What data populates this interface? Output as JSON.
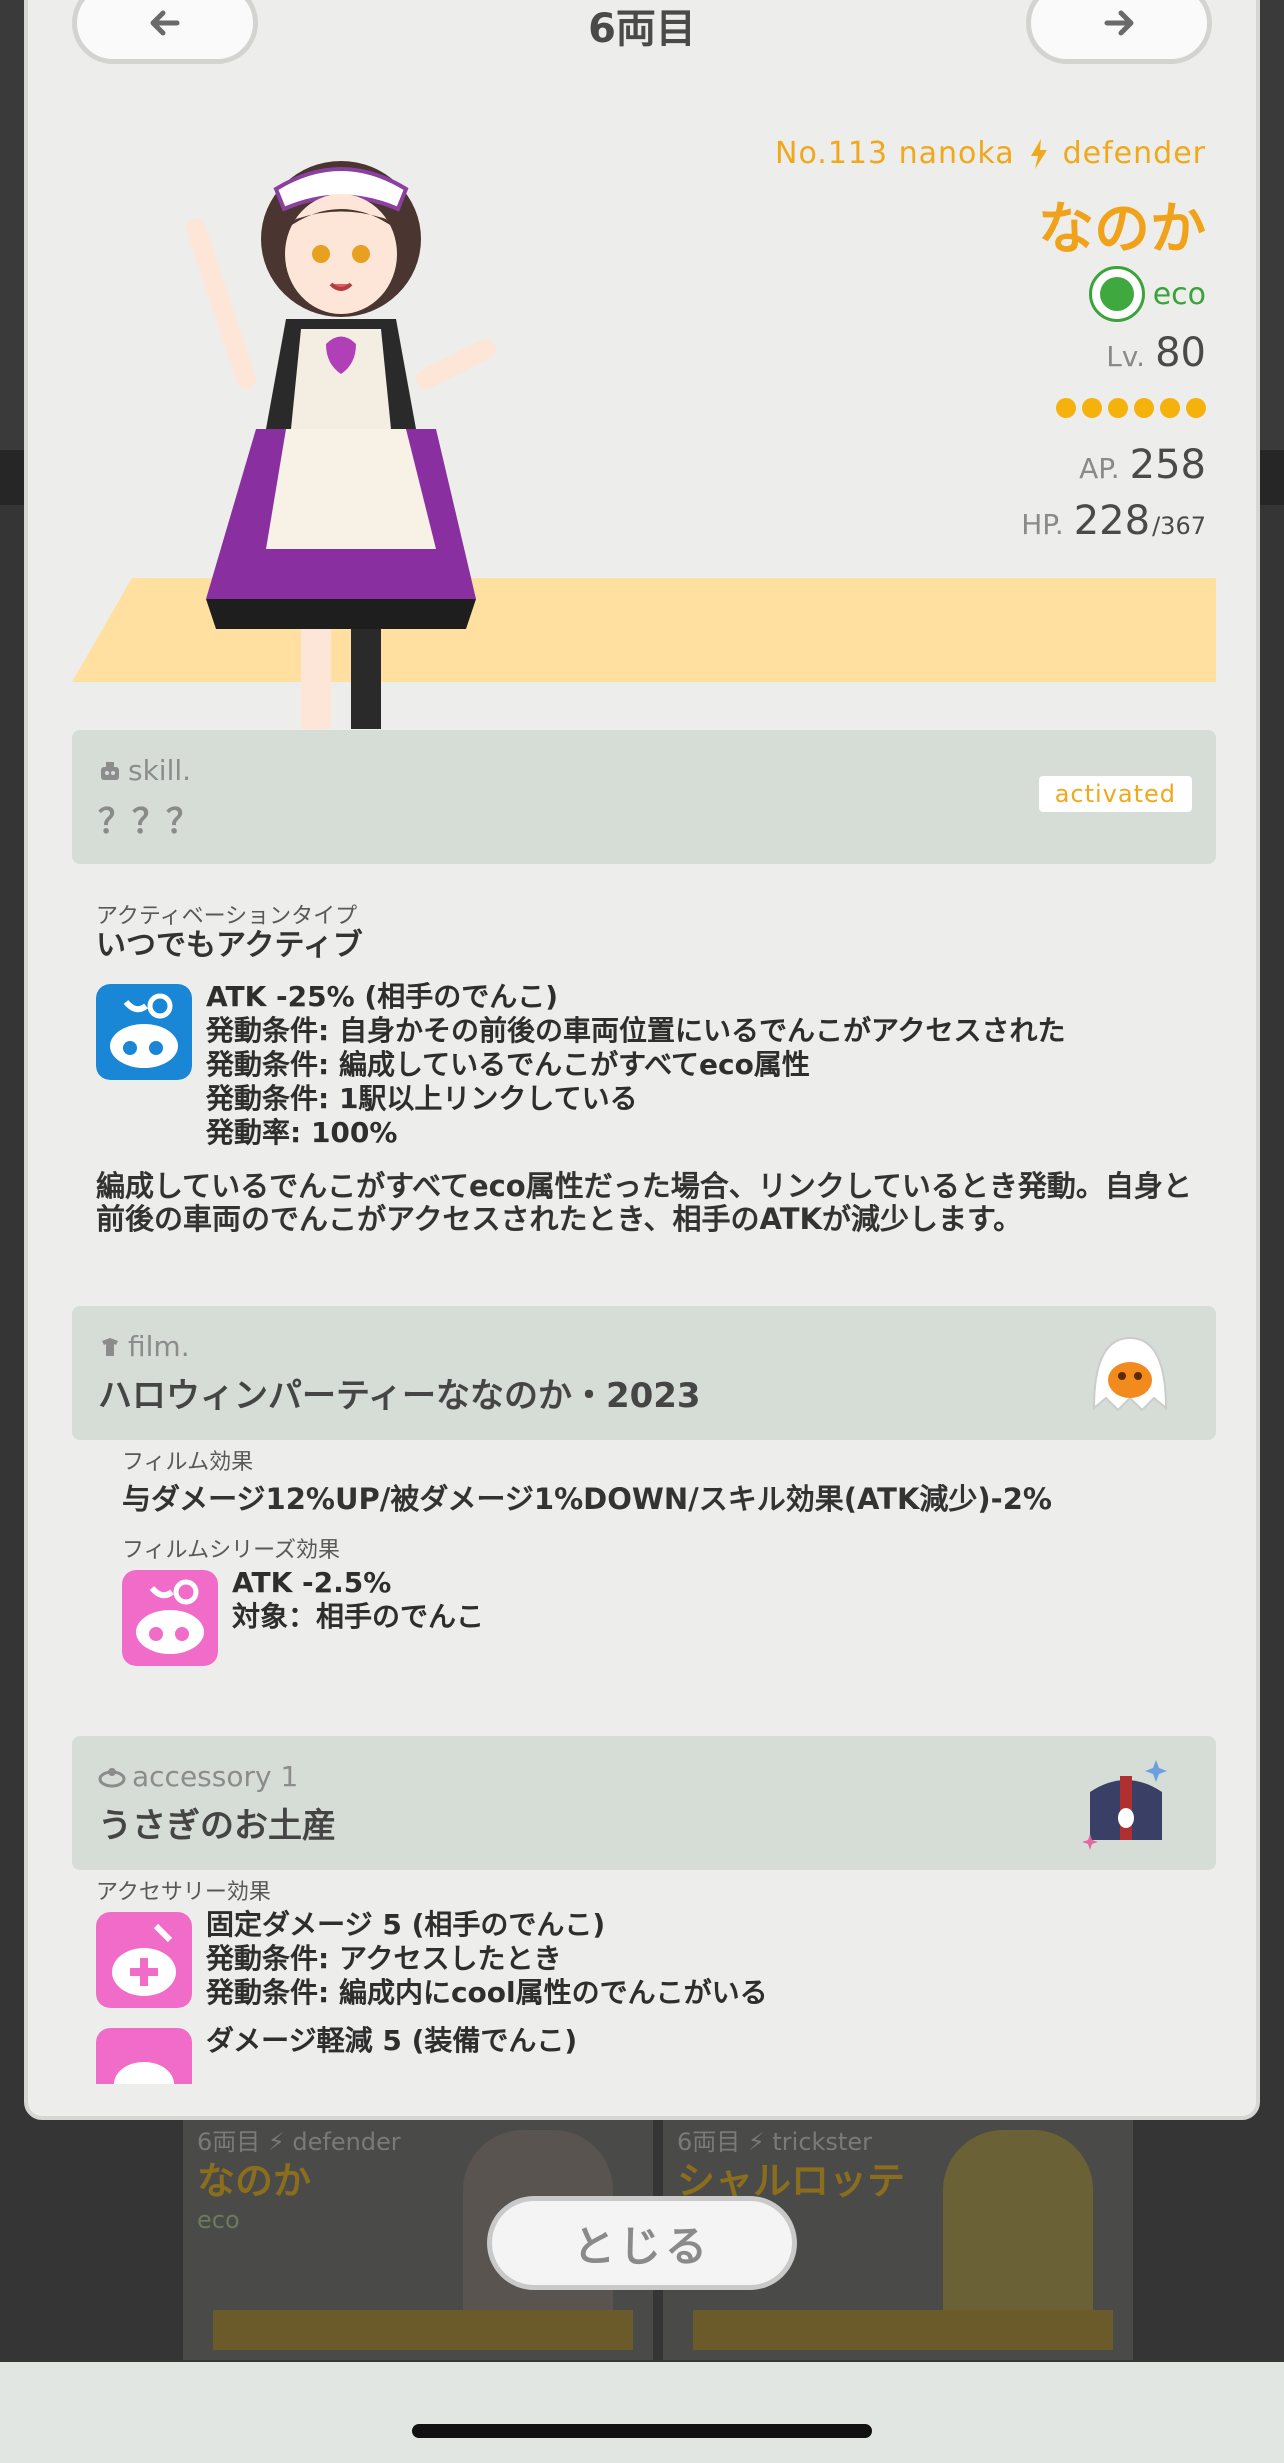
{
  "header": {
    "car_title": "6両目"
  },
  "character": {
    "id_line": "No.113 nanoka",
    "role": "defender",
    "name": "なのか",
    "attribute": "eco",
    "level_label": "Lv.",
    "level": "80",
    "rarity_stars": 6,
    "ap_label": "AP.",
    "ap": "258",
    "hp_label": "HP.",
    "hp": "228",
    "hp_max": "/367"
  },
  "skill": {
    "caption": "skill.",
    "name": "？？？",
    "status": "activated",
    "activation_type_label": "アクティベーションタイプ",
    "activation_type": "いつでもアクティブ",
    "effects": [
      "ATK -25% (相手のでんこ)",
      "発動条件: 自身かその前後の車両位置にいるでんこがアクセスされた",
      "発動条件: 編成しているでんこがすべてeco属性",
      "発動条件: 1駅以上リンクしている",
      "発動率: 100%"
    ],
    "description": "編成しているでんこがすべてeco属性だった場合、リンクしているとき発動。自身と前後の車両のでんこがアクセスされたとき、相手のATKが減少します。"
  },
  "film": {
    "caption": "film.",
    "name": "ハロウィンパーティーななのか・2023",
    "effect_label": "フィルム効果",
    "effect": "与ダメージ12%UP/被ダメージ1%DOWN/スキル効果(ATK減少)-2%",
    "series_label": "フィルムシリーズ効果",
    "series_effects": [
      "ATK -2.5%",
      "対象：相手のでんこ"
    ]
  },
  "accessory": {
    "caption": "accessory 1",
    "name": "うさぎのお土産",
    "effect_label": "アクセサリー効果",
    "effect1": [
      "固定ダメージ 5 (相手のでんこ)",
      "発動条件: アクセスしたとき",
      "発動条件: 編成内にcool属性のでんこがいる"
    ],
    "effect2": [
      "ダメージ軽減 5 (装備でんこ)"
    ]
  },
  "background_cards": [
    {
      "top": "6両目 ⚡ defender",
      "name": "なのか",
      "attr": "eco"
    },
    {
      "top": "6両目 ⚡ trickster",
      "name": "シャルロッテ"
    }
  ],
  "close_button": "とじる",
  "colors": {
    "accent": "#f0a21a",
    "eco": "#3aa33a",
    "panel": "#d6ddd7",
    "pink": "#f06cc8",
    "blue": "#1a86d6"
  }
}
